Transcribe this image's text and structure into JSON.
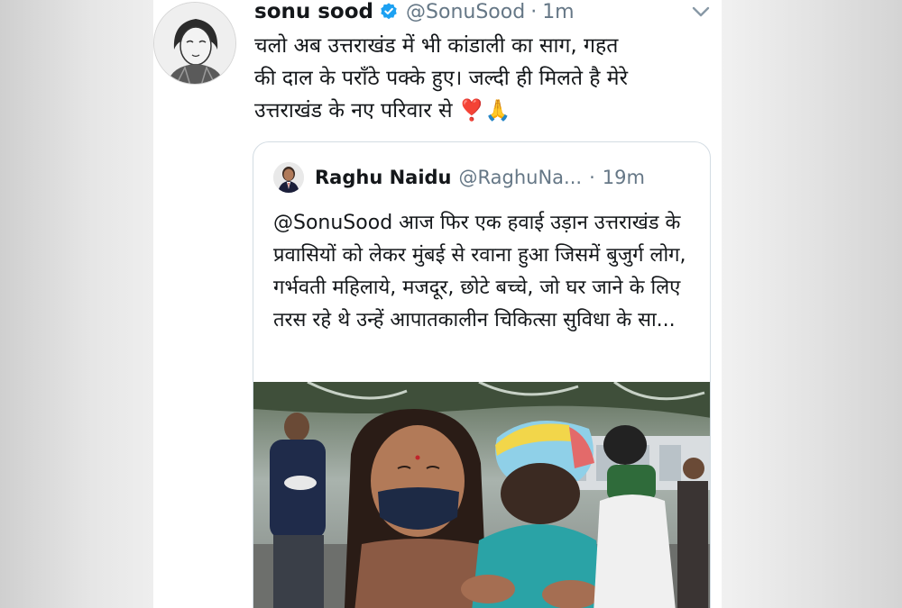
{
  "tweet": {
    "author_name": "sonu sood",
    "author_handle": "@SonuSood",
    "separator": "·",
    "time": "1m",
    "text": "चलो अब उत्तराखंड में भी  कांडाली का साग,  गहत\nकी दाल के पराँठे पक्के हुए। जल्दी ही मिलते है मेरे\nउत्तराखंड के नए परिवार से ",
    "emojis": "❣️🙏"
  },
  "quoted_tweet": {
    "author_name": "Raghu Naidu",
    "author_handle": "@RaghuNa...",
    "separator": "·",
    "time": "19m",
    "text": "@SonuSood आज फिर एक हवाई उड़ान उत्तराखंड के प्रवासियों को लेकर मुंबई से रवाना हुआ जिसमें बुजुर्ग लोग, गर्भवती महिलाये, मजदूर, छोटे बच्चे, जो घर जाने के लिए तरस रहे थे उन्हें आपातकालीन चिकित्सा सुविधा के सा..."
  },
  "icons": {
    "verified": "verified-badge-icon",
    "caret": "chevron-down-icon"
  },
  "colors": {
    "text": "#14171a",
    "secondary": "#657786",
    "verified": "#1da1f2",
    "border": "#d3dce3"
  }
}
